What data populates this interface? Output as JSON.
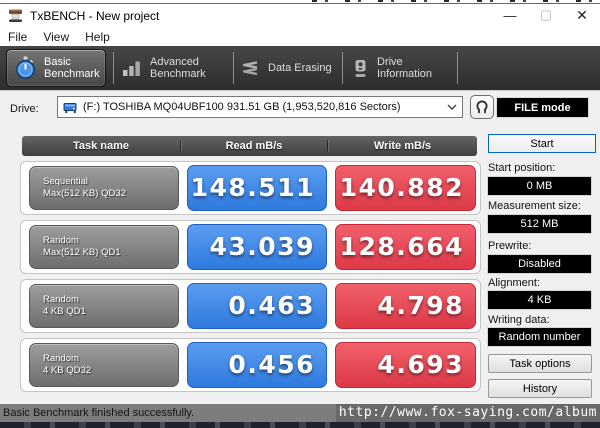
{
  "window": {
    "title": "TxBENCH - New project",
    "controls": {
      "minimize": "—",
      "maximize": "▢",
      "close": "✕"
    }
  },
  "menu": {
    "items": [
      "File",
      "View",
      "Help"
    ]
  },
  "toolbar": {
    "tabs": [
      {
        "line1": "Basic",
        "line2": "Benchmark",
        "selected": true,
        "icon": "stopwatch-icon"
      },
      {
        "line1": "Advanced",
        "line2": "Benchmark",
        "selected": false,
        "icon": "bar-chart-icon"
      },
      {
        "line1": "Data Erasing",
        "line2": "",
        "selected": false,
        "icon": "erase-zigzag-icon"
      },
      {
        "line1": "Drive",
        "line2": "Information",
        "selected": false,
        "icon": "drive-icon"
      }
    ]
  },
  "drive_row": {
    "label": "Drive:",
    "selected_drive": "(F:) TOSHIBA MQ04UBF100  931.51 GB (1,953,520,816 Sectors)",
    "file_mode_label": "FILE mode"
  },
  "table": {
    "headers": [
      "Task name",
      "Read mB/s",
      "Write mB/s"
    ],
    "rows": [
      {
        "task_line1": "Sequential",
        "task_line2": "Max(512 KB) QD32",
        "read": "148.511",
        "write": "140.882"
      },
      {
        "task_line1": "Random",
        "task_line2": "Max(512 KB) QD1",
        "read": "43.039",
        "write": "128.664"
      },
      {
        "task_line1": "Random",
        "task_line2": "4 KB QD1",
        "read": "0.463",
        "write": "4.798"
      },
      {
        "task_line1": "Random",
        "task_line2": "4 KB QD32",
        "read": "0.456",
        "write": "4.693"
      }
    ]
  },
  "side_panel": {
    "start_label": "Start",
    "fields": [
      {
        "label": "Start position:",
        "value": "0 MB"
      },
      {
        "label": "Measurement size:",
        "value": "512 MB"
      },
      {
        "label": "Prewrite:",
        "value": "Disabled"
      },
      {
        "label": "Alignment:",
        "value": "4 KB"
      },
      {
        "label": "Writing data:",
        "value": "Random number"
      }
    ],
    "buttons": [
      "Task options",
      "History"
    ]
  },
  "status_bar": {
    "message": "Basic Benchmark finished successfully.",
    "watermark": "http://www.fox-saying.com/album"
  },
  "colors": {
    "read_blue": "#3b82e0",
    "write_red": "#e2414f",
    "toolbar_dark": "#3a3a3a",
    "value_button_black": "#000000",
    "titlebar_border_blue": "#2f6fc0"
  }
}
